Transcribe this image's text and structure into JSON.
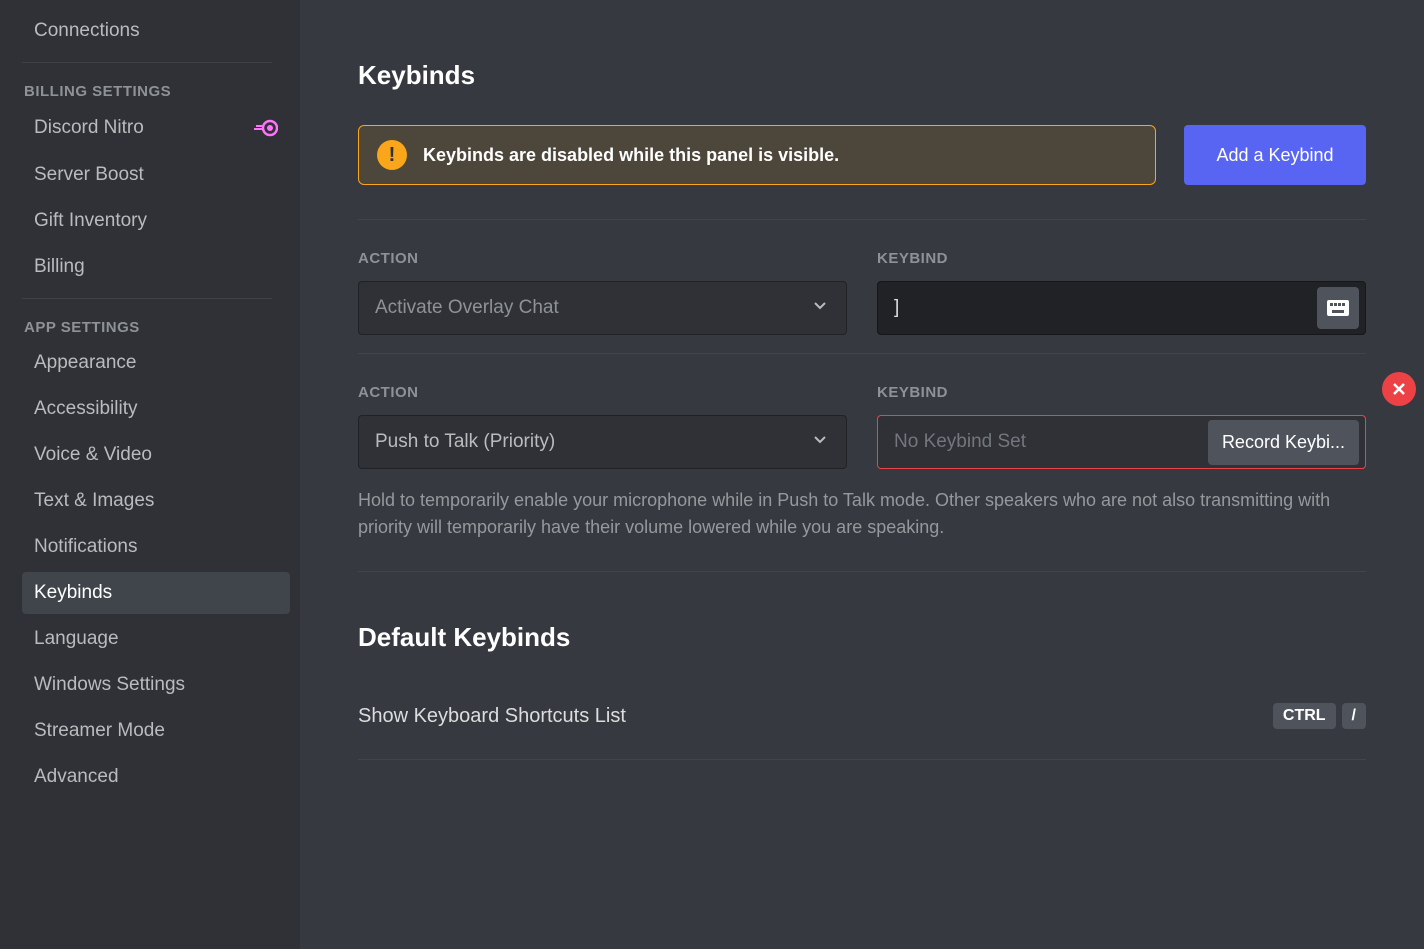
{
  "sidebar": {
    "items_top": [
      {
        "label": "Connections"
      }
    ],
    "section_billing_header": "BILLING SETTINGS",
    "items_billing": [
      {
        "label": "Discord Nitro",
        "has_nitro_badge": true
      },
      {
        "label": "Server Boost"
      },
      {
        "label": "Gift Inventory"
      },
      {
        "label": "Billing"
      }
    ],
    "section_app_header": "APP SETTINGS",
    "items_app": [
      {
        "label": "Appearance"
      },
      {
        "label": "Accessibility"
      },
      {
        "label": "Voice & Video"
      },
      {
        "label": "Text & Images"
      },
      {
        "label": "Notifications"
      },
      {
        "label": "Keybinds",
        "active": true
      },
      {
        "label": "Language"
      },
      {
        "label": "Windows Settings"
      },
      {
        "label": "Streamer Mode"
      },
      {
        "label": "Advanced"
      }
    ]
  },
  "main": {
    "title": "Keybinds",
    "notice_text": "Keybinds are disabled while this panel is visible.",
    "add_button_label": "Add a Keybind",
    "action_label": "ACTION",
    "keybind_label": "KEYBIND",
    "keybind_rows": [
      {
        "action_value": "Activate Overlay Chat",
        "keybind_value": "]",
        "has_keyboard_icon": true
      },
      {
        "action_value": "Push to Talk (Priority)",
        "keybind_placeholder": "No Keybind Set",
        "record_button_label": "Record Keybi...",
        "error": true,
        "description": "Hold to temporarily enable your microphone while in Push to Talk mode. Other speakers who are not also transmitting with priority will temporarily have their volume lowered while you are speaking."
      }
    ],
    "default_section_title": "Default Keybinds",
    "shortcuts": [
      {
        "label": "Show Keyboard Shortcuts List",
        "keys": [
          "CTRL",
          "/"
        ]
      }
    ]
  }
}
